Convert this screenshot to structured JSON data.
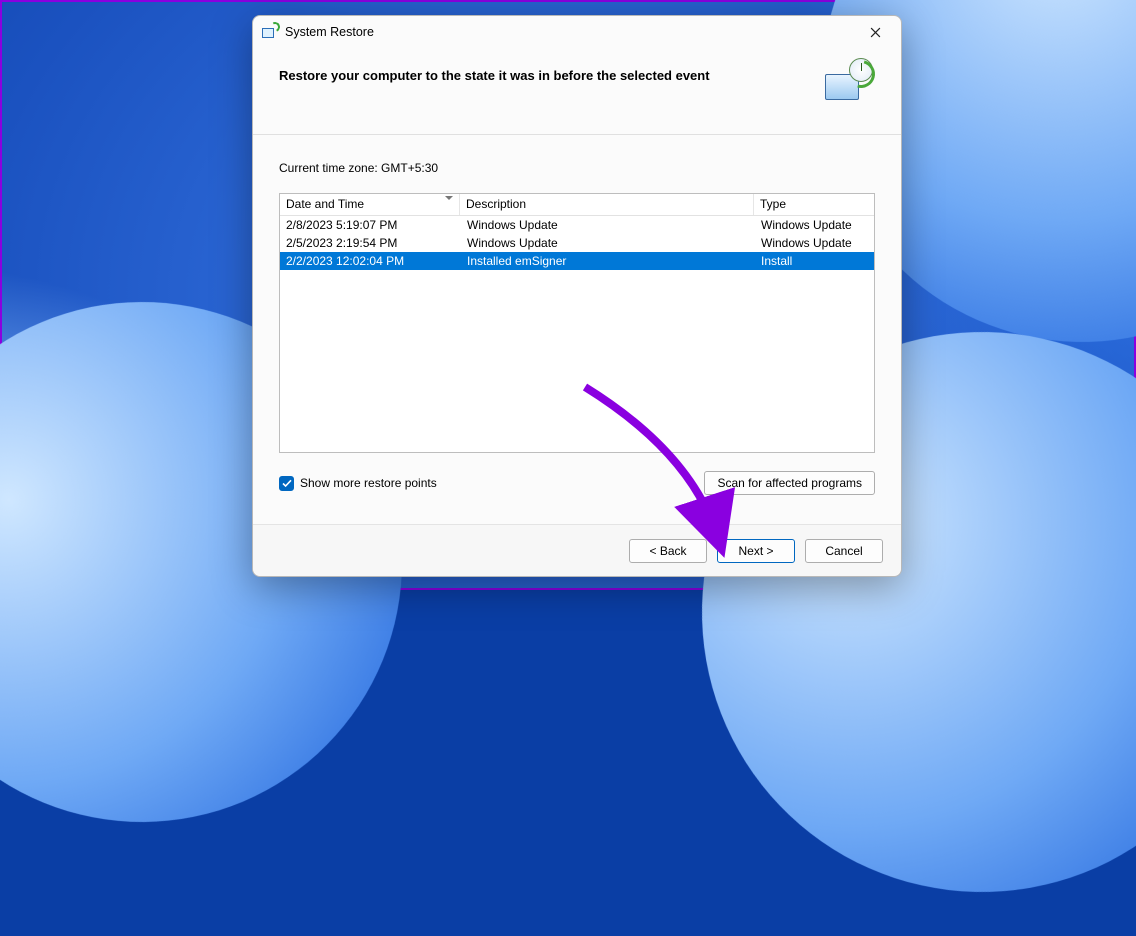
{
  "window": {
    "title": "System Restore",
    "heading": "Restore your computer to the state it was in before the selected event"
  },
  "timezone_label": "Current time zone: GMT+5:30",
  "table": {
    "columns": {
      "datetime": "Date and Time",
      "description": "Description",
      "type": "Type"
    },
    "rows": [
      {
        "datetime": "2/8/2023 5:19:07 PM",
        "description": "Windows Update",
        "type": "Windows Update",
        "selected": false
      },
      {
        "datetime": "2/5/2023 2:19:54 PM",
        "description": "Windows Update",
        "type": "Windows Update",
        "selected": false
      },
      {
        "datetime": "2/2/2023 12:02:04 PM",
        "description": "Installed emSigner",
        "type": "Install",
        "selected": true
      }
    ]
  },
  "checkbox": {
    "label": "Show more restore points",
    "checked": true
  },
  "buttons": {
    "scan": "Scan for affected programs",
    "back": "< Back",
    "next": "Next >",
    "cancel": "Cancel"
  },
  "annotation": {
    "arrow_color": "#8a00e0",
    "target": "next-button"
  }
}
